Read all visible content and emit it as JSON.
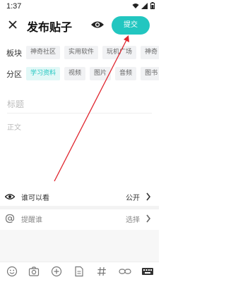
{
  "status_bar": {
    "time": "1:37"
  },
  "header": {
    "title": "发布贴子",
    "submit_label": "提交"
  },
  "board": {
    "label": "板块",
    "options": [
      "神奇社区",
      "实用软件",
      "玩机广场",
      "神奇"
    ]
  },
  "section": {
    "label": "分区",
    "options": [
      "学习资料",
      "视频",
      "图片",
      "音频",
      "图书"
    ],
    "selected": "学习资料"
  },
  "editor": {
    "title_placeholder": "标题",
    "body_placeholder": "正文"
  },
  "visibility": {
    "label": "谁可以看",
    "value": "公开"
  },
  "mention": {
    "label": "提醒谁",
    "value": "选择"
  },
  "toolbar_icons": [
    "emoji-icon",
    "camera-icon",
    "add-icon",
    "file-icon",
    "hashtag-icon",
    "link-icon",
    "keyboard-icon"
  ],
  "colors": {
    "accent": "#22c6c0",
    "annotation_arrow": "#e0262f"
  }
}
